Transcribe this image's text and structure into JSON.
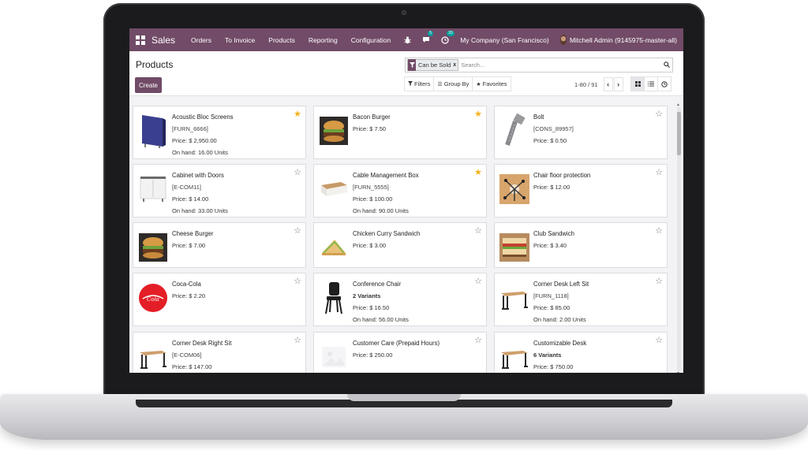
{
  "navbar": {
    "brand": "Sales",
    "menu": [
      "Orders",
      "To Invoice",
      "Products",
      "Reporting",
      "Configuration"
    ],
    "bug_icon": "bug-icon",
    "chat_badge": "5",
    "activity_badge": "33",
    "company": "My Company (San Francisco)",
    "user": "Mitchell Admin (9145975-master-all)"
  },
  "control_panel": {
    "title": "Products",
    "create_label": "Create",
    "facet": {
      "label": "Can be Sold",
      "remove": "x"
    },
    "search_placeholder": "Search...",
    "filters_label": "Filters",
    "groupby_label": "Group By",
    "favorites_label": "Favorites",
    "pager_value": "1-80 / 91",
    "colors": {
      "brand": "#714b67",
      "star_on": "#f3b21a"
    }
  },
  "products": [
    {
      "name": "Acoustic Bloc Screens",
      "ref": "[FURN_6666]",
      "price": "Price: $ 2,950.00",
      "onhand": "On hand: 16.00 Units",
      "starred": true,
      "icon": "acoustic-screen-image"
    },
    {
      "name": "Bacon Burger",
      "price": "Price: $ 7.50",
      "starred": true,
      "icon": "burger-image"
    },
    {
      "name": "Bolt",
      "ref": "[CONS_89957]",
      "price": "Price: $ 0.50",
      "starred": false,
      "icon": "bolt-image"
    },
    {
      "name": "Cabinet with Doors",
      "ref": "[E-COM11]",
      "price": "Price: $ 14.00",
      "onhand": "On hand: 33.00 Units",
      "starred": false,
      "icon": "cabinet-image"
    },
    {
      "name": "Cable Management Box",
      "ref": "[FURN_5555]",
      "price": "Price: $ 100.00",
      "onhand": "On hand: 90.00 Units",
      "starred": true,
      "icon": "cable-box-image"
    },
    {
      "name": "Chair floor protection",
      "price": "Price: $ 12.00",
      "starred": false,
      "icon": "floor-protection-image"
    },
    {
      "name": "Cheese Burger",
      "price": "Price: $ 7.00",
      "starred": false,
      "icon": "burger-image"
    },
    {
      "name": "Chicken Curry Sandwich",
      "price": "Price: $ 3.00",
      "starred": false,
      "icon": "sandwich-image"
    },
    {
      "name": "Club Sandwich",
      "price": "Price: $ 3.40",
      "starred": false,
      "icon": "club-sandwich-image"
    },
    {
      "name": "Coca-Cola",
      "price": "Price: $ 2.20",
      "starred": false,
      "icon": "coca-cola-image"
    },
    {
      "name": "Conference Chair",
      "variants": "2 Variants",
      "price": "Price: $ 16.50",
      "onhand": "On hand: 56.00 Units",
      "starred": false,
      "icon": "chair-image"
    },
    {
      "name": "Corner Desk Left Sit",
      "ref": "[FURN_1118]",
      "price": "Price: $ 85.00",
      "onhand": "On hand: 2.00 Units",
      "starred": false,
      "icon": "desk-image"
    },
    {
      "name": "Corner Desk Right Sit",
      "ref": "[E-COM06]",
      "price": "Price: $ 147.00",
      "starred": false,
      "icon": "desk-image"
    },
    {
      "name": "Customer Care (Prepaid Hours)",
      "price": "Price: $ 250.00",
      "starred": false,
      "icon": "placeholder-image"
    },
    {
      "name": "Customizable Desk",
      "variants": "6 Variants",
      "price": "Price: $ 750.00",
      "starred": false,
      "icon": "desk-image"
    }
  ]
}
